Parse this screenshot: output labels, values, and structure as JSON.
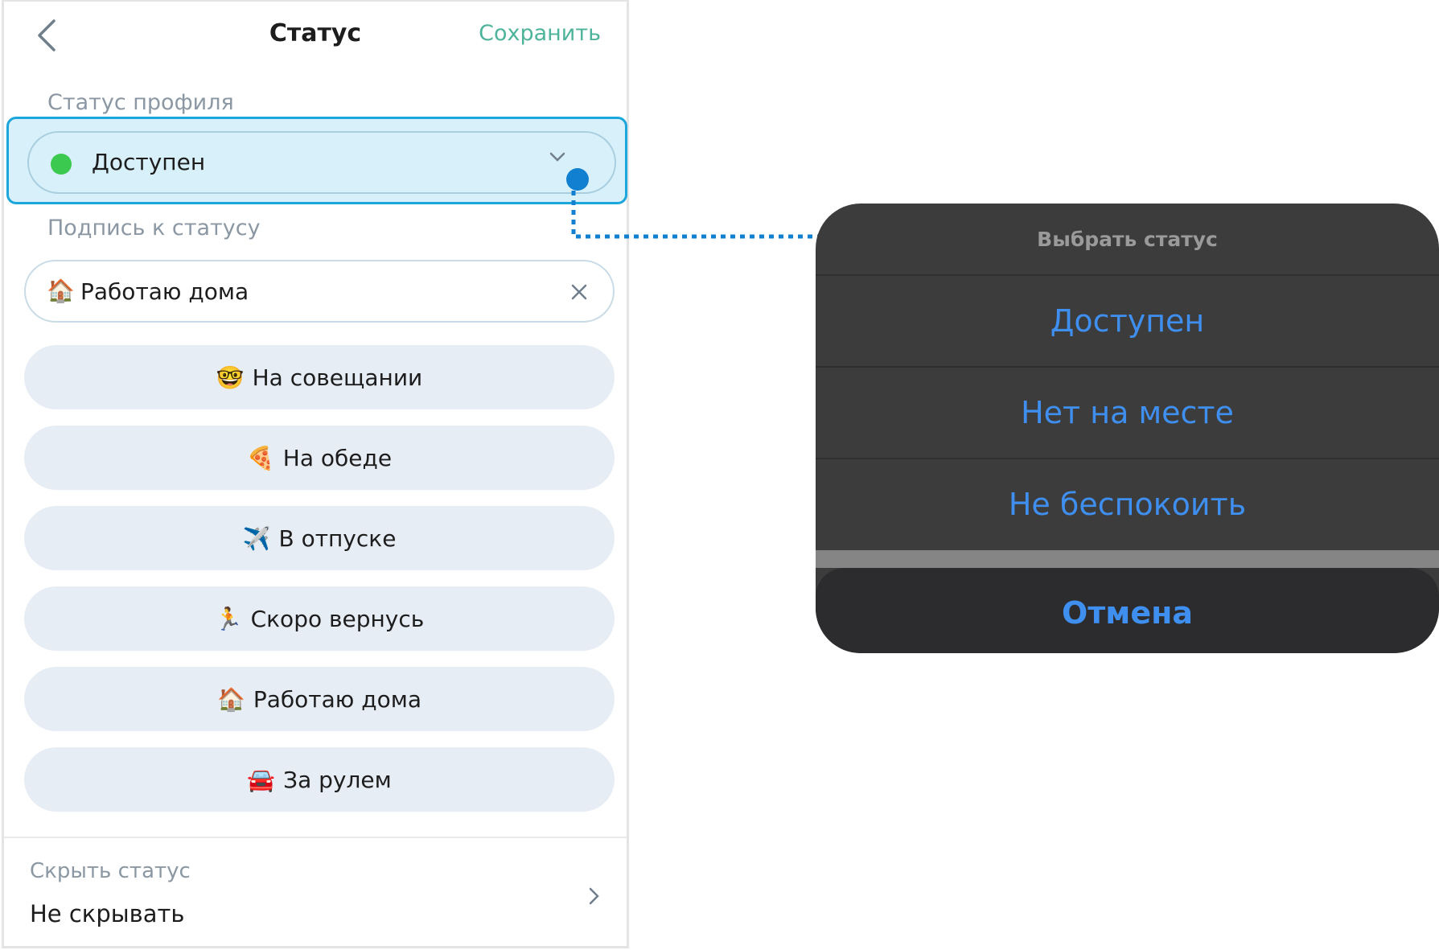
{
  "header": {
    "title": "Статус",
    "save_label": "Сохранить"
  },
  "profile_status": {
    "label": "Статус профиля",
    "value": "Доступен",
    "status_color": "#3cc94f"
  },
  "caption": {
    "label": "Подпись к статусу",
    "emoji": "🏠",
    "value": "Работаю дома"
  },
  "presets": [
    {
      "emoji": "🤓",
      "label": "На совещании"
    },
    {
      "emoji": "🍕",
      "label": "На обеде"
    },
    {
      "emoji": "✈️",
      "label": "В отпуске"
    },
    {
      "emoji": "🏃",
      "label": "Скоро вернусь"
    },
    {
      "emoji": "🏠",
      "label": "Работаю дома"
    },
    {
      "emoji": "🚘",
      "label": "За рулем"
    }
  ],
  "hide_status": {
    "label": "Скрыть статус",
    "value": "Не скрывать"
  },
  "action_sheet": {
    "title": "Выбрать статус",
    "options": [
      "Доступен",
      "Нет на месте",
      "Не беспокоить"
    ],
    "cancel_label": "Отмена"
  },
  "colors": {
    "accent_save": "#4db39a",
    "highlight_border": "#1ba6dc",
    "highlight_fill": "#d8f0fa",
    "action_text": "#3f8ff0",
    "callout": "#1280d0"
  }
}
